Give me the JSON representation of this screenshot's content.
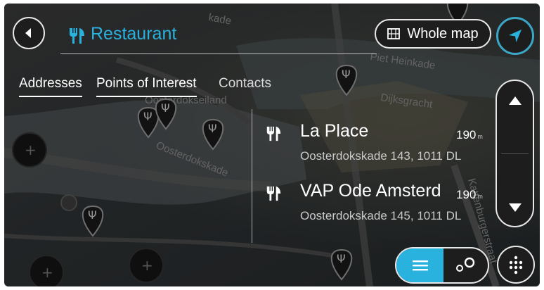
{
  "search": {
    "query": "Restaurant",
    "icon": "fork-knife-icon",
    "back_icon": "back-arrow-icon"
  },
  "header": {
    "whole_map_label": "Whole map",
    "whole_map_icon": "map-icon",
    "nav_icon": "navigation-arrow-icon"
  },
  "tabs": [
    {
      "label": "Addresses",
      "active": true
    },
    {
      "label": "Points of Interest",
      "active": true
    },
    {
      "label": "Contacts",
      "active": false
    }
  ],
  "results": [
    {
      "name": "La Place",
      "distance": "190",
      "unit": "m",
      "address": "Oosterdokskade 143, 1011 DL",
      "icon": "fork-knife-icon"
    },
    {
      "name": "VAP Ode Amsterdam",
      "distance": "190",
      "unit": "m",
      "address": "Oosterdokskade 145, 1011 DL",
      "icon": "fork-knife-icon"
    }
  ],
  "map_labels": {
    "street_1": "Oosterdokskade",
    "street_2": "Dijksgracht",
    "street_3": "Oosterdokseiland",
    "street_4": "Piet Heinkade",
    "street_5": "Kattenburgerstraat",
    "street_6": "kade"
  },
  "controls": {
    "scroll_up_icon": "chevron-up-icon",
    "scroll_down_icon": "chevron-down-icon",
    "list_view_icon": "list-icon",
    "map_view_icon": "map-pins-icon",
    "keyboard_icon": "keyboard-icon"
  },
  "colors": {
    "accent": "#2ab2de",
    "button_bg": "#1d1d1d",
    "button_border": "#e8e8e8"
  }
}
